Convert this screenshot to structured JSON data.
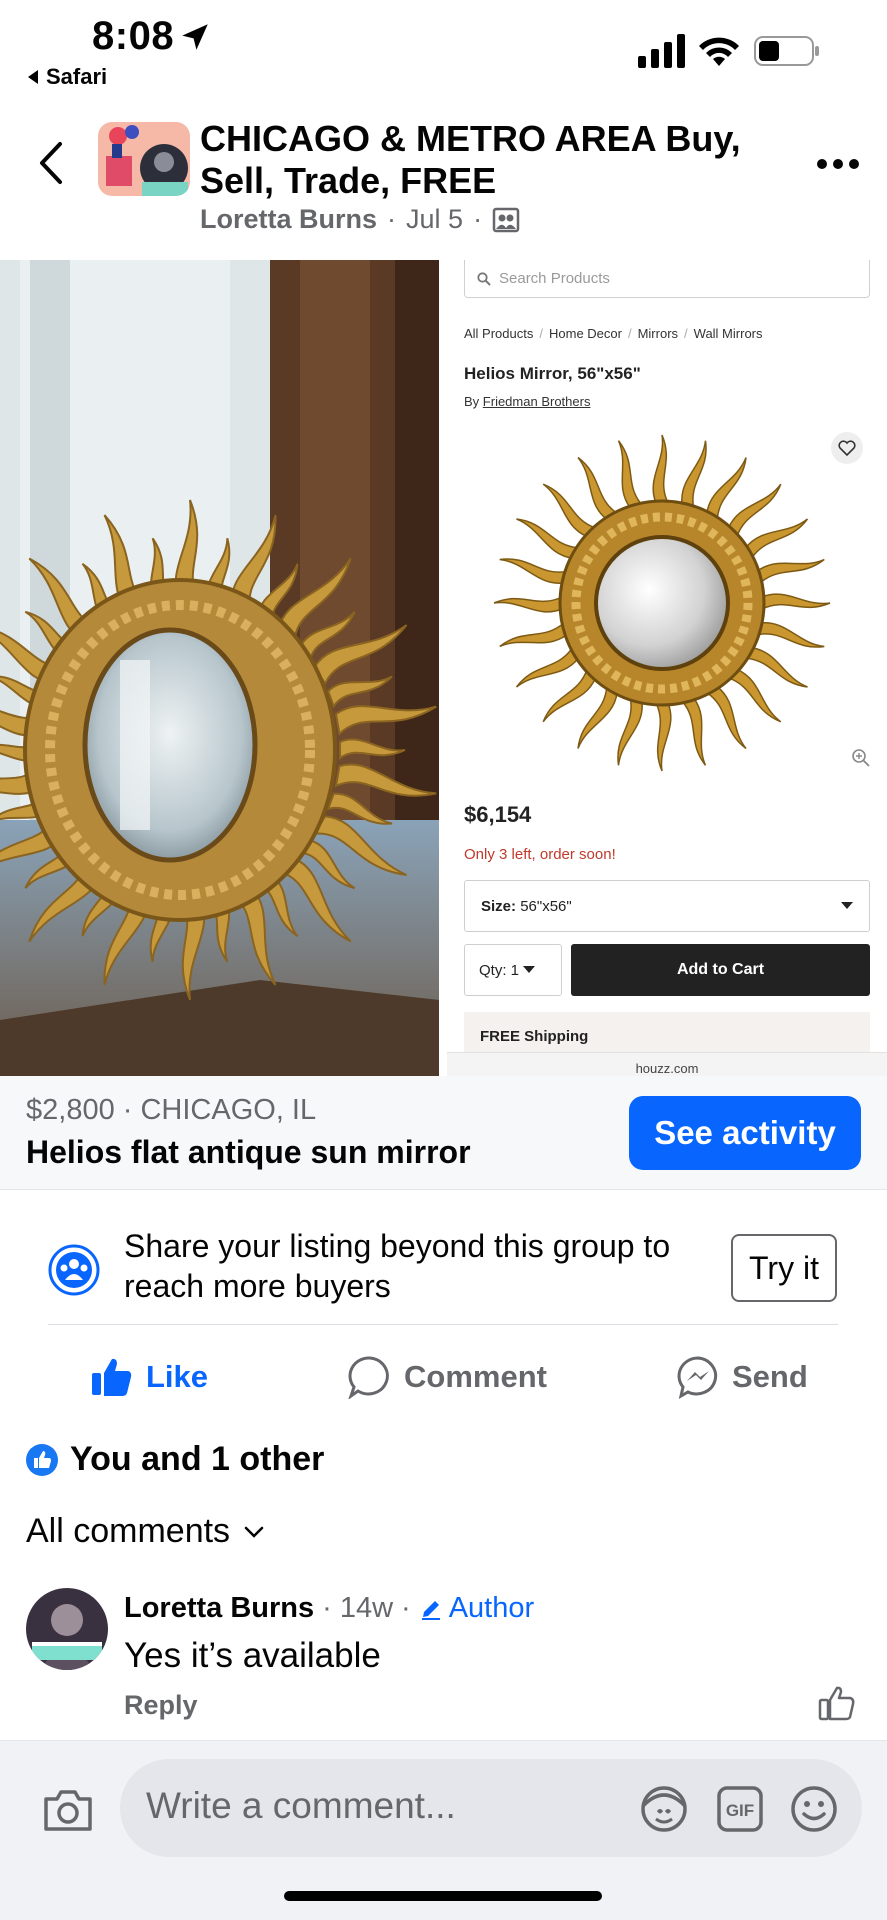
{
  "status_bar": {
    "time": "8:08",
    "back_app": "Safari"
  },
  "header": {
    "group_title": "CHICAGO & METRO AREA Buy, Sell, Trade, FREE",
    "poster": "Loretta Burns",
    "date": "Jul 5"
  },
  "product_screenshot": {
    "search_placeholder": "Search Products",
    "breadcrumbs": [
      "All Products",
      "Home Decor",
      "Mirrors",
      "Wall Mirrors"
    ],
    "title": "Helios Mirror, 56\"x56\"",
    "by_prefix": "By",
    "brand": "Friedman Brothers",
    "price": "$6,154",
    "stock_note": "Only 3 left, order soon!",
    "size_label": "Size:",
    "size_value": "56\"x56\"",
    "qty_label": "Qty: 1",
    "add_to_cart": "Add to Cart",
    "shipping": "FREE Shipping",
    "source": "houzz.com"
  },
  "listing": {
    "price_location": "$2,800 · CHICAGO, IL",
    "title": "Helios flat antique sun mirror",
    "see_activity": "See activity"
  },
  "share": {
    "text": "Share your listing beyond this group to reach more buyers",
    "try_button": "Try it"
  },
  "actions": {
    "like": "Like",
    "comment": "Comment",
    "send": "Send"
  },
  "reactions": {
    "summary": "You and 1 other"
  },
  "comments": {
    "filter": "All comments",
    "items": [
      {
        "author": "Loretta Burns",
        "age": "14w",
        "badge": "Author",
        "text": "Yes it’s available",
        "reply": "Reply"
      }
    ]
  },
  "composer": {
    "placeholder": "Write a comment..."
  },
  "colors": {
    "accent": "#0866ff",
    "secondary_text": "#65676b",
    "stock_warning": "#c0392b"
  },
  "icons": [
    "location-arrow-icon",
    "signal-icon",
    "wifi-icon",
    "battery-icon",
    "back-chevron-icon",
    "more-icon",
    "group-privacy-icon",
    "search-icon",
    "heart-icon",
    "zoom-icon",
    "dropdown-caret-icon",
    "share-audience-icon",
    "like-icon",
    "comment-icon",
    "messenger-icon",
    "like-badge-icon",
    "chevron-down-icon",
    "pencil-icon",
    "thumb-up-outline-icon",
    "camera-icon",
    "avatar-sticker-icon",
    "gif-icon",
    "emoji-icon"
  ]
}
